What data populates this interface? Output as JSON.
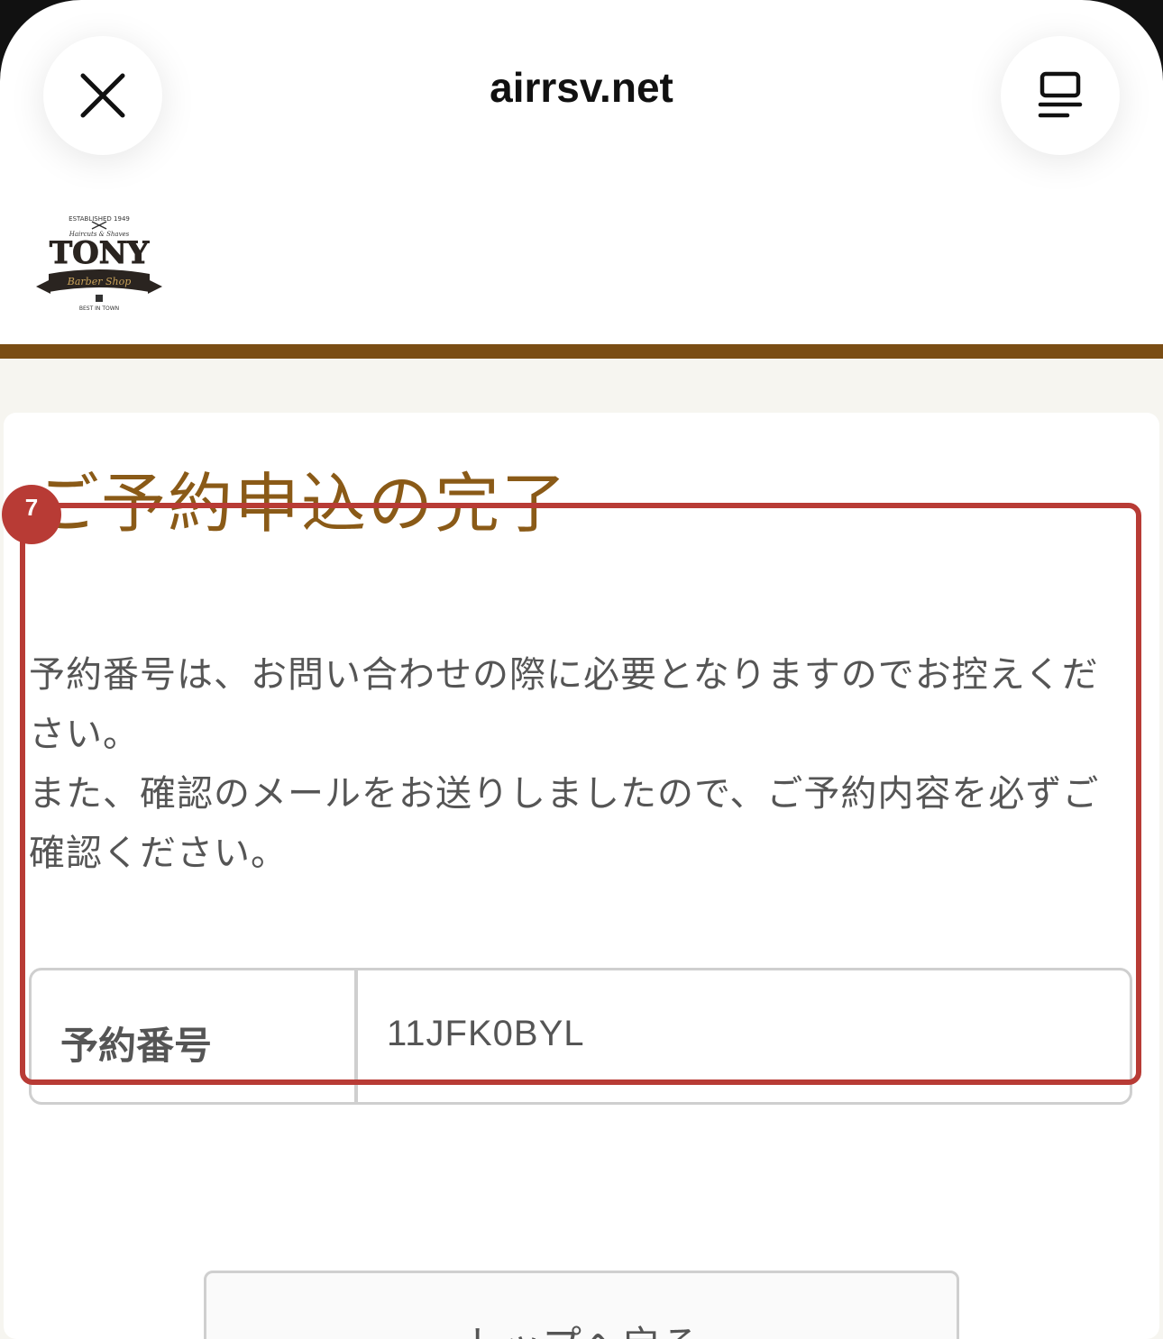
{
  "browser": {
    "url": "airrsv.net",
    "close_icon": "close-icon",
    "menu_icon": "reader-menu-icon"
  },
  "site": {
    "logo_text": {
      "top": "ESTABLISHED 1949",
      "sub": "Haircuts & Shaves",
      "name": "TONY",
      "ribbon": "Barber Shop",
      "bottom": "BEST IN TOWN"
    },
    "accent_color": "#7a4d14"
  },
  "page": {
    "title": "ご予約申込の完了",
    "message_line1": "予約番号は、お問い合わせの際に必要となりますのでお控えください。",
    "message_line2": "また、確認のメールをお送りしましたので、ご予約内容を必ずご確認ください。",
    "reservation": {
      "label": "予約番号",
      "value": "11JFK0BYL"
    },
    "back_button": "トップへ戻る"
  },
  "annotation": {
    "badge": "7",
    "color": "#b83b35"
  }
}
